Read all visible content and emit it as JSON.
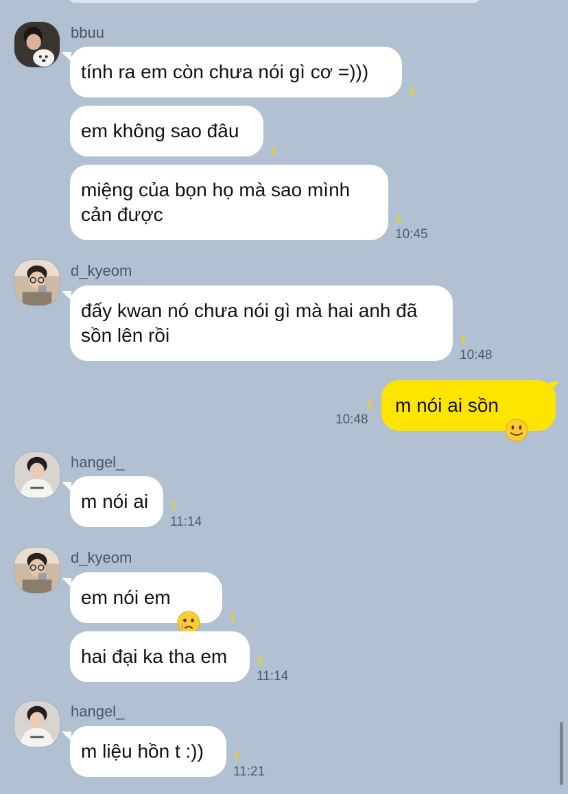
{
  "chat": {
    "groups": [
      {
        "sender": "bbuu",
        "avatar_icon": "avatar-person-with-dog-icon",
        "messages": [
          {
            "text": "tính ra em còn chưa nói gì cơ =)))",
            "unread": "1",
            "time": ""
          },
          {
            "text": "em không sao đâu",
            "unread": "1",
            "time": ""
          },
          {
            "text": "miệng của bọn họ mà sao mình\ncản được",
            "unread": "1",
            "time": "10:45"
          }
        ]
      },
      {
        "sender": "d_kyeom",
        "avatar_icon": "avatar-mirror-selfie-icon",
        "messages": [
          {
            "text": "đấy kwan nó chưa nói gì mà hai anh đã\nsồn lên rồi",
            "unread": "1",
            "time": "10:48"
          }
        ]
      },
      {
        "sender": "",
        "mine": true,
        "messages": [
          {
            "text": "m nói ai sồn",
            "emoji": "slightly-smiling-face-icon",
            "unread": "1",
            "time": "10:48"
          }
        ]
      },
      {
        "sender": "hangel_",
        "avatar_icon": "avatar-person-white-shirt-icon",
        "messages": [
          {
            "text": "m nói ai",
            "unread": "1",
            "time": "11:14"
          }
        ]
      },
      {
        "sender": "d_kyeom",
        "avatar_icon": "avatar-mirror-selfie-icon",
        "messages": [
          {
            "text": "em nói em",
            "emoji": "face-holding-back-tears-icon",
            "unread": "1",
            "time": ""
          },
          {
            "text": "hai đại ka tha em",
            "unread": "1",
            "time": "11:14"
          }
        ]
      },
      {
        "sender": "hangel_",
        "avatar_icon": "avatar-person-white-shirt-icon",
        "messages": [
          {
            "text": "m liệu hồn t :))",
            "unread": "1",
            "time": "11:21"
          }
        ]
      }
    ]
  },
  "colors": {
    "background": "#b1c1d1",
    "incoming_bubble": "#ffffff",
    "outgoing_bubble": "#fee500",
    "unread_count": "#f0d21b",
    "timestamp": "#505a66"
  }
}
